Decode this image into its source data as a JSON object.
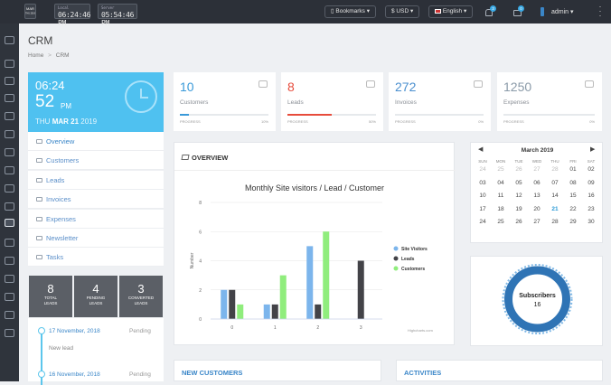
{
  "topbar": {
    "clocks": [
      {
        "label": "Local",
        "value": "06:24:46 PM"
      },
      {
        "label": "Server",
        "value": "05:54:46 PM"
      }
    ],
    "date_badge_top": "MAR",
    "date_badge_bottom": "THU 2019",
    "bookmarks_label": "Bookmarks",
    "currency_label": "$ USD",
    "language_label": "English",
    "notif_count": "3",
    "msg_count": "0",
    "user_label": "admin"
  },
  "page": {
    "title": "CRM",
    "breadcrumb": [
      "Home",
      "CRM"
    ],
    "breadcrumb_sep": ">"
  },
  "clock_widget": {
    "time": "06:24",
    "seconds": "52",
    "ampm": "PM",
    "day": "THU",
    "date": "MAR 21",
    "year": "2019"
  },
  "stats": [
    {
      "value": "10",
      "label": "Customers",
      "progress_label": "PROGRESS",
      "percent": "10%",
      "progress": 0.1,
      "color": "#3a9ad9"
    },
    {
      "value": "8",
      "label": "Leads",
      "progress_label": "PROGRESS",
      "percent": "50%",
      "progress": 0.5,
      "color": "#e74c3c"
    },
    {
      "value": "272",
      "label": "Invoices",
      "progress_label": "PROGRESS",
      "percent": "0%",
      "progress": 0.0,
      "color": "#3a9ad9"
    },
    {
      "value": "1250",
      "label": "Expenses",
      "progress_label": "PROGRESS",
      "percent": "0%",
      "progress": 0.0,
      "color": "#3a9ad9"
    }
  ],
  "menu": [
    "Overview",
    "Customers",
    "Leads",
    "Invoices",
    "Expenses",
    "Newsletter",
    "Tasks"
  ],
  "lead_stats": [
    {
      "value": "8",
      "label_1": "TOTAL",
      "label_2": "LEADS"
    },
    {
      "value": "4",
      "label_1": "PENDING",
      "label_2": "LEADS"
    },
    {
      "value": "3",
      "label_1": "CONVERTED",
      "label_2": "LEADS"
    }
  ],
  "timeline": [
    {
      "date": "17 November, 2018",
      "status": "Pending",
      "note": "New lead"
    },
    {
      "date": "16 November, 2018",
      "status": "Pending"
    }
  ],
  "overview": {
    "title": "OVERVIEW",
    "credit": "Highcharts.com"
  },
  "chart_data": {
    "type": "bar",
    "title": "Monthly Site visitors / Lead / Customer",
    "ylabel": "Number",
    "xlabel": "",
    "categories": [
      "0",
      "1",
      "2",
      "3"
    ],
    "yticks": [
      "0",
      "2",
      "4",
      "6",
      "8"
    ],
    "ylim": [
      0,
      8
    ],
    "legend_position": "right",
    "series": [
      {
        "name": "Site Visitors",
        "color": "#7cb5ec",
        "values": [
          2,
          1,
          5,
          0
        ]
      },
      {
        "name": "Leads",
        "color": "#434348",
        "values": [
          2,
          1,
          1,
          4
        ]
      },
      {
        "name": "Customers",
        "color": "#90ed7d",
        "values": [
          1,
          3,
          6,
          0
        ]
      }
    ]
  },
  "calendar": {
    "title": "March 2019",
    "prev": "◀",
    "next": "▶",
    "weekdays": [
      "SUN",
      "MON",
      "TUE",
      "WED",
      "THU",
      "FRI",
      "SAT"
    ],
    "days": [
      "24",
      "25",
      "26",
      "27",
      "28",
      "01",
      "02",
      "03",
      "04",
      "05",
      "06",
      "07",
      "08",
      "09",
      "10",
      "11",
      "12",
      "13",
      "14",
      "15",
      "16",
      "17",
      "18",
      "19",
      "20",
      "21",
      "22",
      "23",
      "24",
      "25",
      "26",
      "27",
      "28",
      "29",
      "30"
    ],
    "muted_count": 5,
    "today_index": 25
  },
  "subscribers": {
    "label": "Subscribers",
    "count": "16"
  },
  "bottom": {
    "new_customers": "NEW CUSTOMERS",
    "activities": "ACTIVITIES"
  }
}
